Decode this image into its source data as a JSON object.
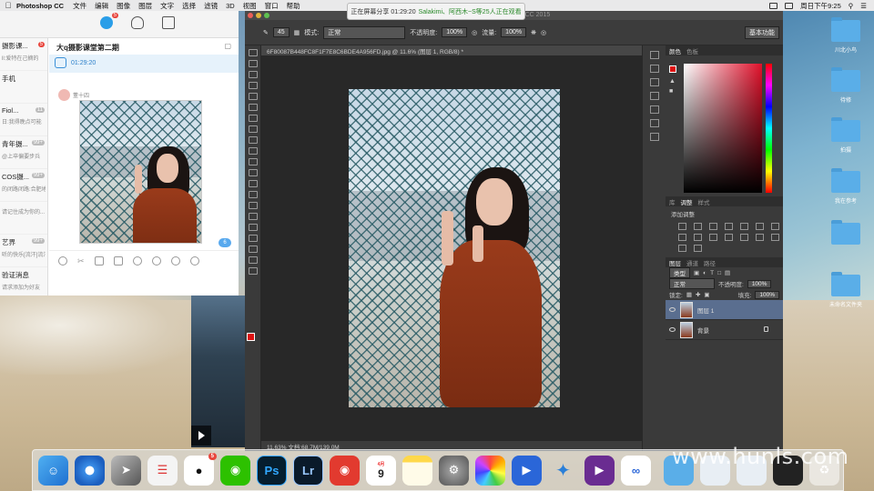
{
  "menubar": {
    "app_name": "Photoshop CC",
    "menus": [
      "文件",
      "编辑",
      "图像",
      "图层",
      "文字",
      "选择",
      "滤镜",
      "3D",
      "视图",
      "窗口",
      "帮助"
    ],
    "clock": "周日下午9:25"
  },
  "share_banner": {
    "text": "正在屏幕分享 01:29:20",
    "viewers": "Salakimi、阿西木~S等25人正在观看"
  },
  "chat": {
    "nav_badge": "5",
    "conversations": [
      {
        "name": "摄影课...",
        "preview": "ll:爱特在己摘的",
        "count": "5"
      },
      {
        "name": "手机",
        "preview": "",
        "count": ""
      },
      {
        "name": "Fiol...",
        "preview": "日:我得晚点可能",
        "count": "11"
      },
      {
        "name": "青年摄...",
        "preview": "@上卒偏要步兵",
        "count": "99+"
      },
      {
        "name": "COS摄...",
        "preview": "的闭路闭路:合肥地...",
        "count": "99+"
      },
      {
        "name": "",
        "preview": "请记住成为你的...",
        "count": ""
      },
      {
        "name": "艺界",
        "preview": "听的快乐[流汗]流汗",
        "count": "99+"
      },
      {
        "name": "验证消息",
        "preview": "请求添加为好友",
        "count": ""
      }
    ],
    "title": "大q摄影课堂第二期",
    "live_time": "01:29:20",
    "sender": "董十四",
    "unread": "6"
  },
  "photoshop": {
    "window_title": "Adobe Photoshop CC 2015",
    "options": {
      "brush_size": "45",
      "mode_label": "模式:",
      "mode_value": "正常",
      "opacity_label": "不透明度:",
      "opacity_value": "100%",
      "flow_label": "流量:",
      "flow_value": "100%",
      "workspace": "基本功能"
    },
    "doc_tab": "6F80087B448FC8F1F7E8C6BDE4A956FD.jpg @ 11.6% (图层 1, RGB/8) *",
    "status": "11.63%     文档:68.7M/139.0M",
    "color_tabs": [
      "颜色",
      "色板"
    ],
    "adjust_tabs": [
      "库",
      "调整",
      "样式"
    ],
    "add_adjustment": "添加调整",
    "layer_tabs": [
      "图层",
      "通道",
      "路径"
    ],
    "kind": "类型",
    "blend": "正常",
    "opacity_label": "不透明度:",
    "opacity": "100%",
    "lock_label": "锁定:",
    "fill_label": "填充:",
    "fill": "100%",
    "layers": [
      {
        "name": "图层 1",
        "active": true
      },
      {
        "name": "背景",
        "active": false
      }
    ]
  },
  "desktop_folders": [
    "川北小鸟",
    "待修",
    "拍摄",
    "我在参考",
    "",
    "未命名文件夹"
  ],
  "dock": {
    "qq_badge": "5",
    "calendar_day": "9",
    "calendar_month": "4月"
  },
  "watermark": "www.hunls.com"
}
